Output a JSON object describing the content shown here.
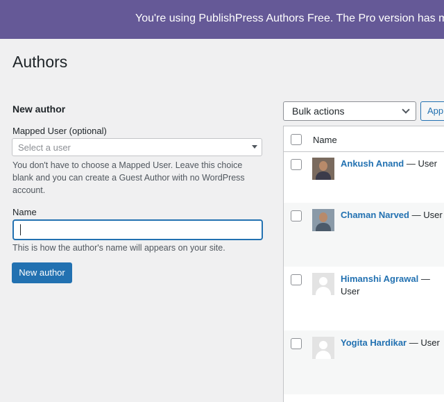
{
  "banner": {
    "text": "You're using PublishPress Authors Free. The Pro version has more"
  },
  "page": {
    "title": "Authors"
  },
  "form": {
    "section_title": "New author",
    "mapped_user": {
      "label": "Mapped User (optional)",
      "placeholder": "Select a user",
      "help": "You don't have to choose a Mapped User. Leave this choice blank and you can create a Guest Author with no WordPress account."
    },
    "name": {
      "label": "Name",
      "value": "",
      "help": "This is how the author's name will appears on your site."
    },
    "submit_label": "New author"
  },
  "bulk": {
    "selected": "Bulk actions",
    "apply_label": "Apply"
  },
  "table": {
    "header_name": "Name",
    "rows": [
      {
        "name": "Ankush Anand",
        "role": "— User",
        "avatar": "photo"
      },
      {
        "name": "Chaman Narved",
        "role": "— User",
        "avatar": "photo"
      },
      {
        "name": "Himanshi Agrawal",
        "role": "— User",
        "avatar": "default"
      },
      {
        "name": "Yogita Hardikar",
        "role": "— User",
        "avatar": "default"
      }
    ]
  },
  "colors": {
    "banner_bg": "#655997",
    "primary": "#2271b1",
    "page_bg": "#f0f0f1"
  }
}
